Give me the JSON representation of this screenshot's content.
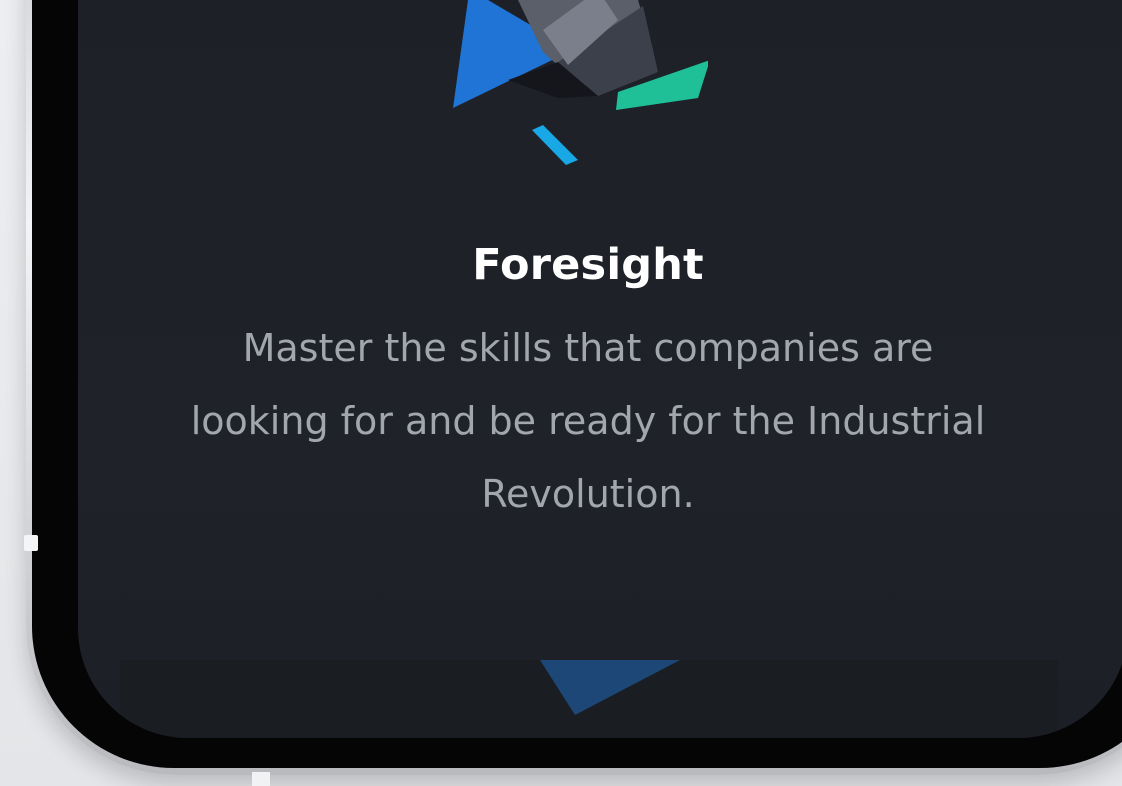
{
  "onboarding": {
    "title": "Foresight",
    "description": "Master the skills that companies are looking for and be ready for the Industrial Revolution."
  },
  "illustration": {
    "name": "geometric-shards-illustration",
    "colors": {
      "blue": "#1f74d6",
      "slate": "#5b5f6a",
      "dark_slate": "#3a3e47",
      "teal": "#1fbf97",
      "cyan": "#18a8e6"
    }
  },
  "theme": {
    "background": "#1f2229",
    "title_color": "#ffffff",
    "text_color": "#a2a6ae"
  }
}
